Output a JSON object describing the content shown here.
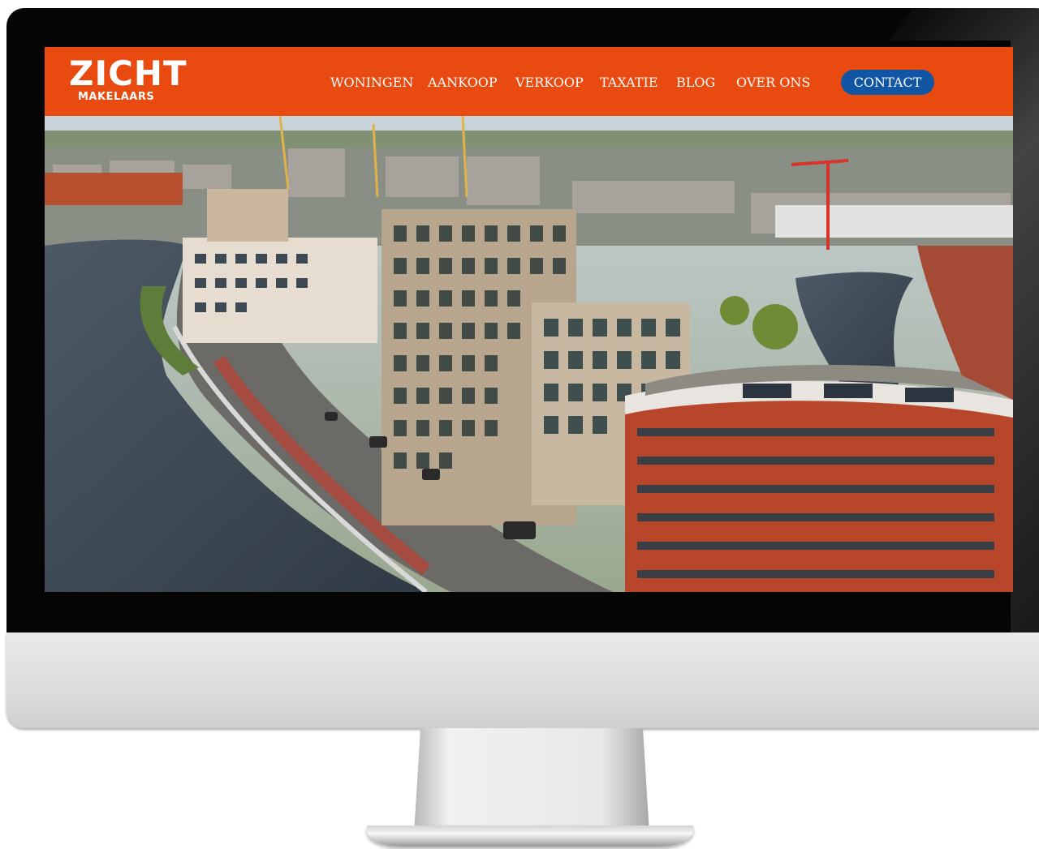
{
  "site": {
    "logo_main": "ZICHT",
    "logo_sub": "MAKELAARS",
    "brand_color": "#e84a0f",
    "contact_color": "#1156a5"
  },
  "nav": {
    "items": [
      {
        "label": "WONINGEN"
      },
      {
        "label": "AANKOOP"
      },
      {
        "label": "VERKOOP"
      },
      {
        "label": "TAXATIE"
      },
      {
        "label": "BLOG"
      },
      {
        "label": "OVER ONS"
      }
    ],
    "contact_label": "CONTACT"
  },
  "hero": {
    "image": "aerial-city-waterfront-photo"
  }
}
